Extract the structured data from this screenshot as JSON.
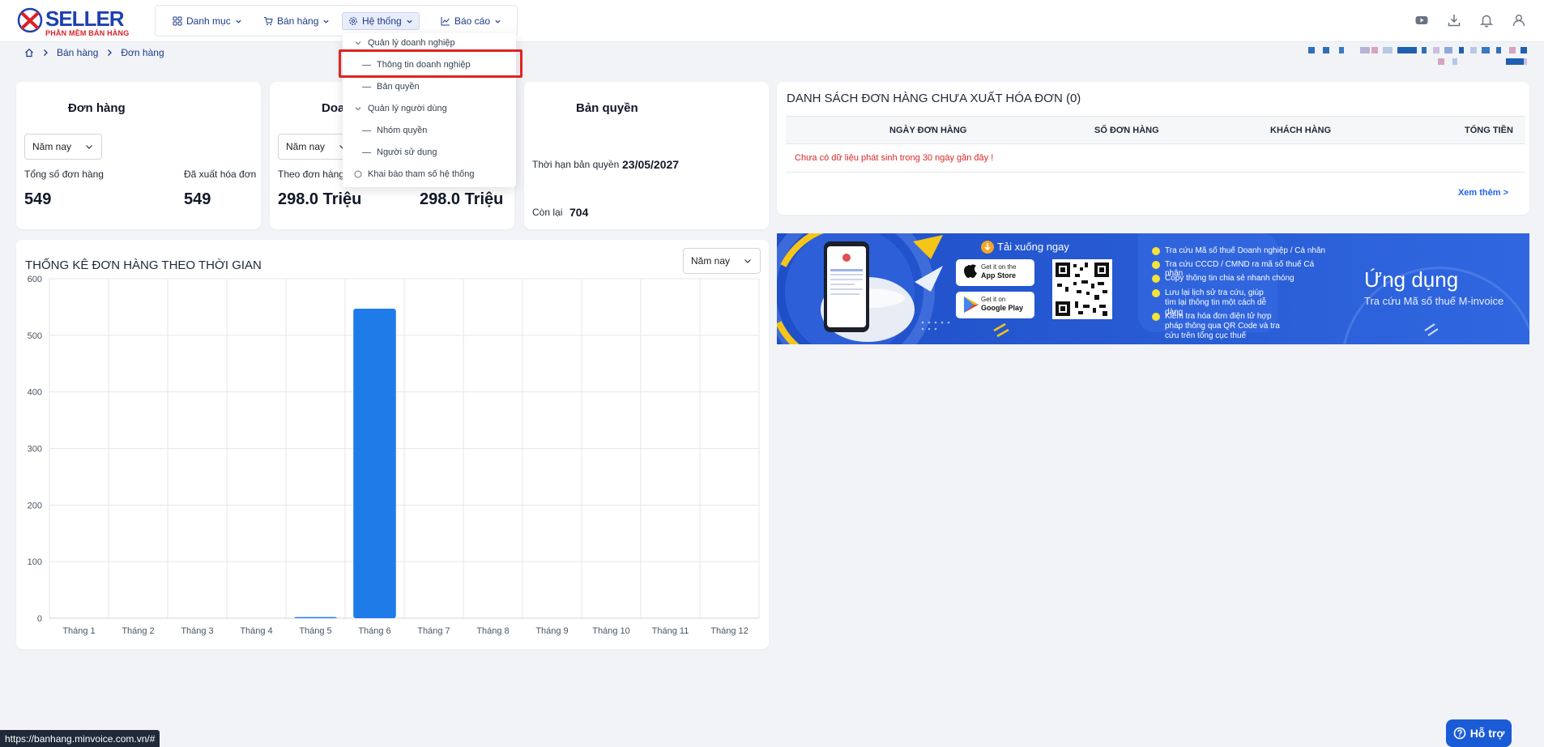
{
  "logo": {
    "brand": "SELLER",
    "subtitle": "PHẦN MỀM BÁN HÀNG"
  },
  "nav": {
    "items": [
      {
        "label": "Danh mục",
        "icon": "grid-icon"
      },
      {
        "label": "Bán hàng",
        "icon": "cart-icon"
      },
      {
        "label": "Hệ thống",
        "icon": "gear-icon"
      },
      {
        "label": "Báo cáo",
        "icon": "chart-icon"
      }
    ],
    "active": "Hệ thống"
  },
  "header_icons": [
    "youtube-icon",
    "download-icon",
    "bell-icon",
    "user-icon"
  ],
  "breadcrumb": {
    "items": [
      "Bán hàng",
      "Đơn hàng"
    ]
  },
  "dropdown": {
    "items": [
      {
        "label": "Quản lý doanh nghiệp",
        "type": "group"
      },
      {
        "label": "Thông tin doanh nghiệp",
        "type": "child",
        "highlighted": true
      },
      {
        "label": "Bản quyền",
        "type": "child"
      },
      {
        "label": "Quản lý người dùng",
        "type": "group"
      },
      {
        "label": "Nhóm quyền",
        "type": "child"
      },
      {
        "label": "Người sử dụng",
        "type": "child"
      },
      {
        "label": "Khai báo tham số hệ thống",
        "type": "radio"
      }
    ]
  },
  "orders_card": {
    "title": "Đơn hàng",
    "period": "Năm nay",
    "total_label": "Tổng số đơn hàng",
    "total_value": "549",
    "invoiced_label": "Đã xuất hóa đơn",
    "invoiced_value": "549"
  },
  "revenue_card": {
    "title_visible": "Doa",
    "period": "Năm nay",
    "by_order_label": "Theo đơn hàng",
    "by_order_value": "298.0 Triệu",
    "second_value": "298.0 Triệu"
  },
  "license_card": {
    "title": "Bản quyền",
    "expiry_label": "Thời hạn bản quyền",
    "expiry_value": "23/05/2027",
    "remaining_label": "Còn lại",
    "remaining_value": "704"
  },
  "invoice_table": {
    "title": "DANH SÁCH ĐƠN HÀNG CHƯA XUẤT HÓA ĐƠN (0)",
    "columns": [
      "NGÀY ĐƠN HÀNG",
      "SỐ ĐƠN HÀNG",
      "KHÁCH HÀNG",
      "TỔNG TIỀN"
    ],
    "empty_message": "Chưa có dữ liệu phát sinh trong 30 ngày gần đây !",
    "see_more": "Xem thêm >"
  },
  "banner": {
    "download_now": "Tải xuống ngay",
    "app_store_line1": "Get it on the",
    "app_store_line2": "App Store",
    "google_play_line1": "Get it on",
    "google_play_line2": "Google Play",
    "features": [
      "Tra cứu Mã số thuế Doanh nghiệp / Cá nhân",
      "Tra cứu CCCD / CMND ra mã số thuế Cá nhân",
      "Copy thông tin chia sẻ nhanh chóng",
      "Lưu lại lịch sử tra cứu, giúp tìm lại thông tin một cách dễ dàng",
      "Kiểm tra hóa đơn điện tử hợp pháp thông qua QR Code và tra cứu trên tổng cục thuế"
    ],
    "app_title": "Ứng dụng",
    "app_subtitle": "Tra cứu Mã số thuế M-invoice"
  },
  "chart_card": {
    "title": "THỐNG KÊ ĐƠN HÀNG THEO THỜI GIAN",
    "period": "Năm nay"
  },
  "chart_data": {
    "type": "bar",
    "categories": [
      "Tháng 1",
      "Tháng 2",
      "Tháng 3",
      "Tháng 4",
      "Tháng 5",
      "Tháng 6",
      "Tháng 7",
      "Tháng 8",
      "Tháng 9",
      "Tháng 10",
      "Tháng 11",
      "Tháng 12"
    ],
    "values": [
      0,
      0,
      0,
      0,
      2,
      547,
      0,
      0,
      0,
      0,
      0,
      0
    ],
    "yticks": [
      0,
      100,
      200,
      300,
      400,
      500,
      600
    ],
    "ylim": [
      0,
      600
    ],
    "bar_color": "#1e7be8",
    "grid": true
  },
  "status_bar": {
    "url": "https://banhang.minvoice.com.vn/#"
  },
  "help_button": {
    "label": "Hỗ trợ"
  }
}
